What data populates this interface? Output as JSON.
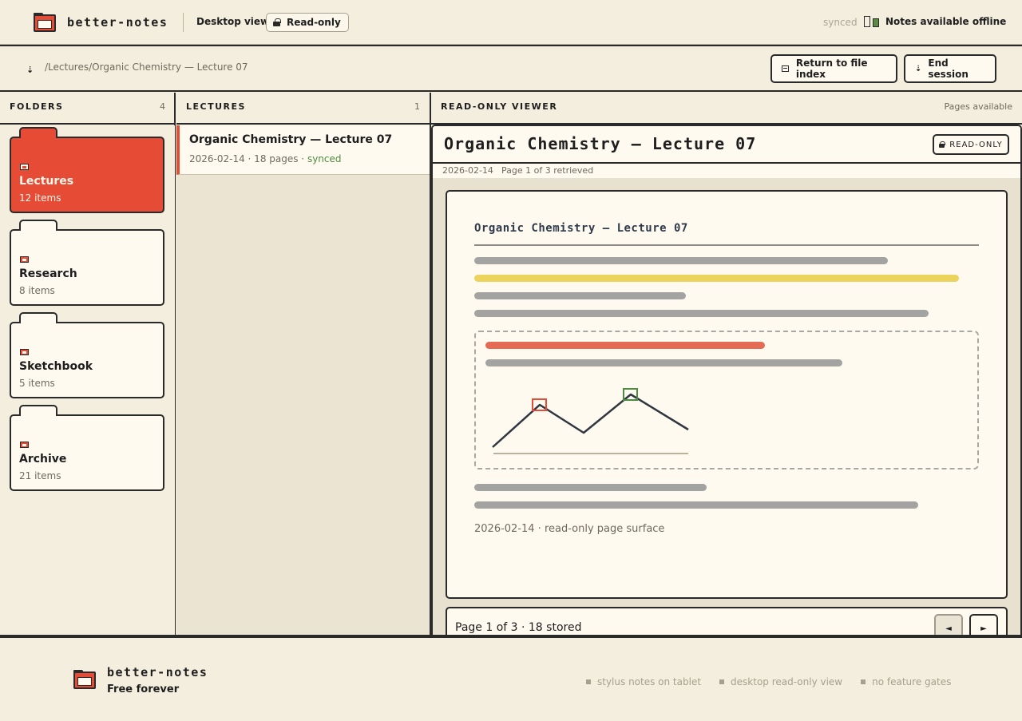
{
  "app": {
    "name": "better-notes",
    "view_mode": "Desktop view",
    "access_mode": "Read-only",
    "sync_status": "synced",
    "offline_status": "Notes available offline",
    "accent_color": "#e54b35",
    "success_color": "#4e8a3f"
  },
  "path": {
    "icon": "download-arrow-icon",
    "breadcrumb": "/Lectures/Organic Chemistry — Lecture 07"
  },
  "actions": {
    "return_label": "Return to file index",
    "end_label": "End session"
  },
  "folders": {
    "header": "FOLDERS",
    "count": "4",
    "items": [
      {
        "name": "Lectures",
        "count": "12 items",
        "active": true
      },
      {
        "name": "Research",
        "count": "8 items",
        "active": false
      },
      {
        "name": "Sketchbook",
        "count": "5 items",
        "active": false
      },
      {
        "name": "Archive",
        "count": "21 items",
        "active": false
      }
    ]
  },
  "lectures": {
    "header": "LECTURES",
    "count": "1",
    "items": [
      {
        "title": "Organic Chemistry — Lecture 07",
        "meta": "2026-02-14 · 18 pages · ",
        "status": "synced"
      }
    ]
  },
  "viewer": {
    "header": "READ-ONLY VIEWER",
    "status": "Pages available",
    "title": "Organic Chemistry – Lecture 07",
    "badge": "READ-ONLY",
    "date": "2026-02-14",
    "retrieved": "Page 1 of 3 retrieved",
    "page": {
      "title": "Organic Chemistry – Lecture 07",
      "footer": "2026-02-14 · read-only page surface"
    },
    "pager": {
      "text": "Page 1 of 3 · 18 stored",
      "prev": "◄",
      "next": "►"
    }
  },
  "footer": {
    "name": "better-notes",
    "tagline": "Free forever",
    "features": [
      "stylus notes on tablet",
      "desktop read-only view",
      "no feature gates"
    ]
  }
}
